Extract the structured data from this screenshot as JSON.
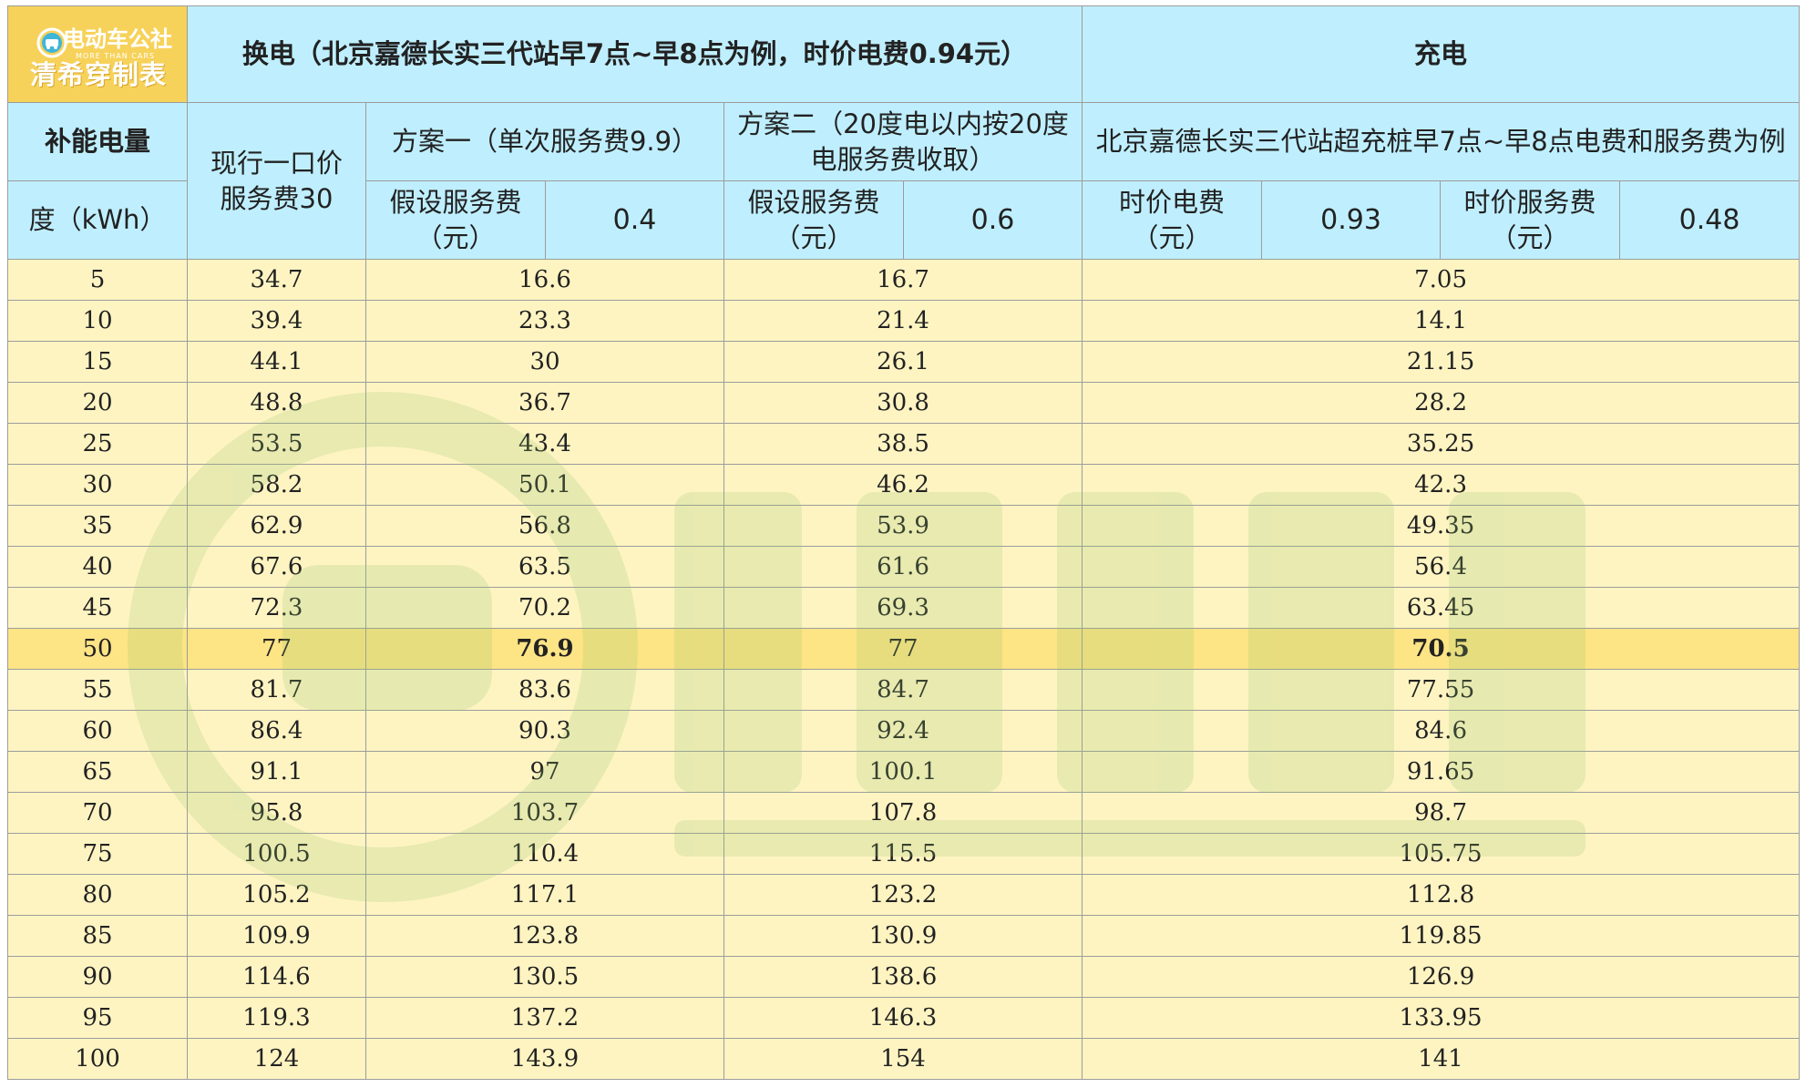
{
  "logo": {
    "brand_top": "电动车公社",
    "brand_sub": "MORE THAN CARS",
    "brand_main": "清希穿制表"
  },
  "header": {
    "swap_title": "换电（北京嘉德长实三代站早7点~早8点为例，时价电费0.94元）",
    "charge_title": "充电",
    "energy_label": "补能电量",
    "unit_label": "度（kWh）",
    "current_price": "现行一口价服务费30",
    "plan1_title": "方案一（单次服务费9.9）",
    "plan1_fee_label": "假设服务费（元）",
    "plan1_fee_value": "0.4",
    "plan2_title": "方案二（20度电以内按20度电服务费收取）",
    "plan2_fee_label": "假设服务费（元）",
    "plan2_fee_value": "0.6",
    "charge_desc": "北京嘉德长实三代站超充桩早7点~早8点电费和服务费为例",
    "elec_fee_label": "时价电费（元）",
    "elec_fee_value": "0.93",
    "service_fee_label": "时价服务费（元）",
    "service_fee_value": "0.48"
  },
  "rows": [
    {
      "kwh": "5",
      "current": "34.7",
      "plan1": "16.6",
      "plan2": "16.7",
      "charge": "7.05"
    },
    {
      "kwh": "10",
      "current": "39.4",
      "plan1": "23.3",
      "plan2": "21.4",
      "charge": "14.1"
    },
    {
      "kwh": "15",
      "current": "44.1",
      "plan1": "30",
      "plan2": "26.1",
      "charge": "21.15"
    },
    {
      "kwh": "20",
      "current": "48.8",
      "plan1": "36.7",
      "plan2": "30.8",
      "charge": "28.2"
    },
    {
      "kwh": "25",
      "current": "53.5",
      "plan1": "43.4",
      "plan2": "38.5",
      "charge": "35.25"
    },
    {
      "kwh": "30",
      "current": "58.2",
      "plan1": "50.1",
      "plan2": "46.2",
      "charge": "42.3"
    },
    {
      "kwh": "35",
      "current": "62.9",
      "plan1": "56.8",
      "plan2": "53.9",
      "charge": "49.35"
    },
    {
      "kwh": "40",
      "current": "67.6",
      "plan1": "63.5",
      "plan2": "61.6",
      "charge": "56.4"
    },
    {
      "kwh": "45",
      "current": "72.3",
      "plan1": "70.2",
      "plan2": "69.3",
      "charge": "63.45"
    },
    {
      "kwh": "50",
      "current": "77",
      "plan1": "76.9",
      "plan2": "77",
      "charge": "70.5",
      "highlight": true
    },
    {
      "kwh": "55",
      "current": "81.7",
      "plan1": "83.6",
      "plan2": "84.7",
      "charge": "77.55"
    },
    {
      "kwh": "60",
      "current": "86.4",
      "plan1": "90.3",
      "plan2": "92.4",
      "charge": "84.6"
    },
    {
      "kwh": "65",
      "current": "91.1",
      "plan1": "97",
      "plan2": "100.1",
      "charge": "91.65"
    },
    {
      "kwh": "70",
      "current": "95.8",
      "plan1": "103.7",
      "plan2": "107.8",
      "charge": "98.7"
    },
    {
      "kwh": "75",
      "current": "100.5",
      "plan1": "110.4",
      "plan2": "115.5",
      "charge": "105.75"
    },
    {
      "kwh": "80",
      "current": "105.2",
      "plan1": "117.1",
      "plan2": "123.2",
      "charge": "112.8"
    },
    {
      "kwh": "85",
      "current": "109.9",
      "plan1": "123.8",
      "plan2": "130.9",
      "charge": "119.85"
    },
    {
      "kwh": "90",
      "current": "114.6",
      "plan1": "130.5",
      "plan2": "138.6",
      "charge": "126.9"
    },
    {
      "kwh": "95",
      "current": "119.3",
      "plan1": "137.2",
      "plan2": "146.3",
      "charge": "133.95"
    },
    {
      "kwh": "100",
      "current": "124",
      "plan1": "143.9",
      "plan2": "154",
      "charge": "141"
    }
  ],
  "colors": {
    "header_bg": "#bfefff",
    "logo_bg": "#f7d25a",
    "row_bg": "#fef4c2",
    "highlight_bg": "#fde485",
    "accent_red": "#b43a2e",
    "watermark_green": "#cfe7b4"
  },
  "icons": {
    "logo": "car-plug-icon",
    "watermark": "brand-watermark-icon"
  }
}
